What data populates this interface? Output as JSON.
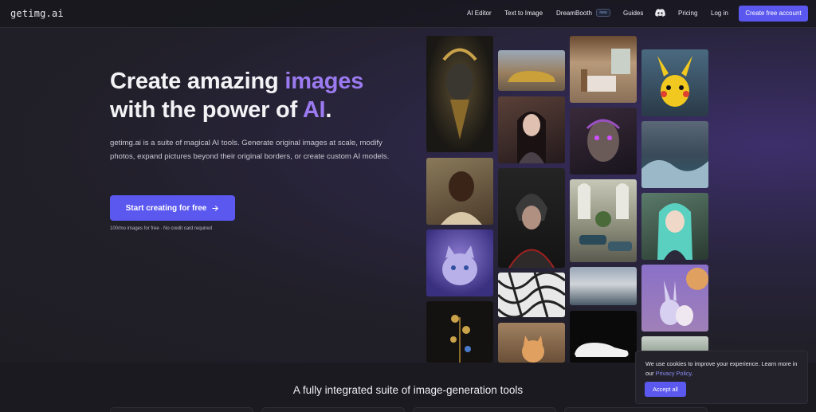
{
  "nav": {
    "logo": "getimg.ai",
    "items": [
      "AI Editor",
      "Text to Image",
      "DreamBooth",
      "Guides",
      "Pricing",
      "Log in"
    ],
    "badge": "new",
    "discord_icon": "discord-icon",
    "cta": "Create free account"
  },
  "hero": {
    "title_part1": "Create amazing ",
    "title_highlight1": "images",
    "title_part2": "with the power of ",
    "title_highlight2": "AI",
    "title_end": ".",
    "subtitle": "getimg.ai is a suite of magical AI tools. Generate original images at scale, modify photos, expand pictures beyond their original borders, or create custom AI models.",
    "cta": "Start creating for free",
    "cta_icon": "arrow-right-icon",
    "note": "100/mo images for free · No credit card required"
  },
  "gallery": {
    "tiles": [
      {
        "subject": "golden mask sculpture",
        "color": "#2a2620"
      },
      {
        "subject": "smiling man portrait",
        "color": "#6b5340"
      },
      {
        "subject": "fluffy cat in galaxy",
        "color": "#5a4a9a"
      },
      {
        "subject": "golden flowers",
        "color": "#2b2518"
      },
      {
        "subject": "sports car on road",
        "color": "#8a7560"
      },
      {
        "subject": "woman in armor",
        "color": "#3a2a2c"
      },
      {
        "subject": "armored warrior",
        "color": "#2c2a2a"
      },
      {
        "subject": "white lattice pattern",
        "color": "#cfcfcf"
      },
      {
        "subject": "cat in kitchen",
        "color": "#8a6a4a"
      },
      {
        "subject": "bedroom interior",
        "color": "#9a8068"
      },
      {
        "subject": "cyborg face",
        "color": "#3a2a3a"
      },
      {
        "subject": "vintage cars in hall",
        "color": "#7a7a6a"
      },
      {
        "subject": "clouds over sea",
        "color": "#7a8aa0"
      },
      {
        "subject": "white sneaker",
        "color": "#111111"
      },
      {
        "subject": "pikachu toy",
        "color": "#3a5a70"
      },
      {
        "subject": "stormy ocean wave",
        "color": "#4a5a6a"
      },
      {
        "subject": "anime girl",
        "color": "#4a6a5a"
      },
      {
        "subject": "bunny and cat",
        "color": "#6a5a9a"
      },
      {
        "subject": "garden",
        "color": "#7a8a7a"
      }
    ]
  },
  "section": {
    "title": "A fully integrated suite of image-generation tools"
  },
  "cookie": {
    "text": "We use cookies to improve your experience. Learn more in our ",
    "link": "Privacy Policy",
    "end": ".",
    "button": "Accept all"
  }
}
